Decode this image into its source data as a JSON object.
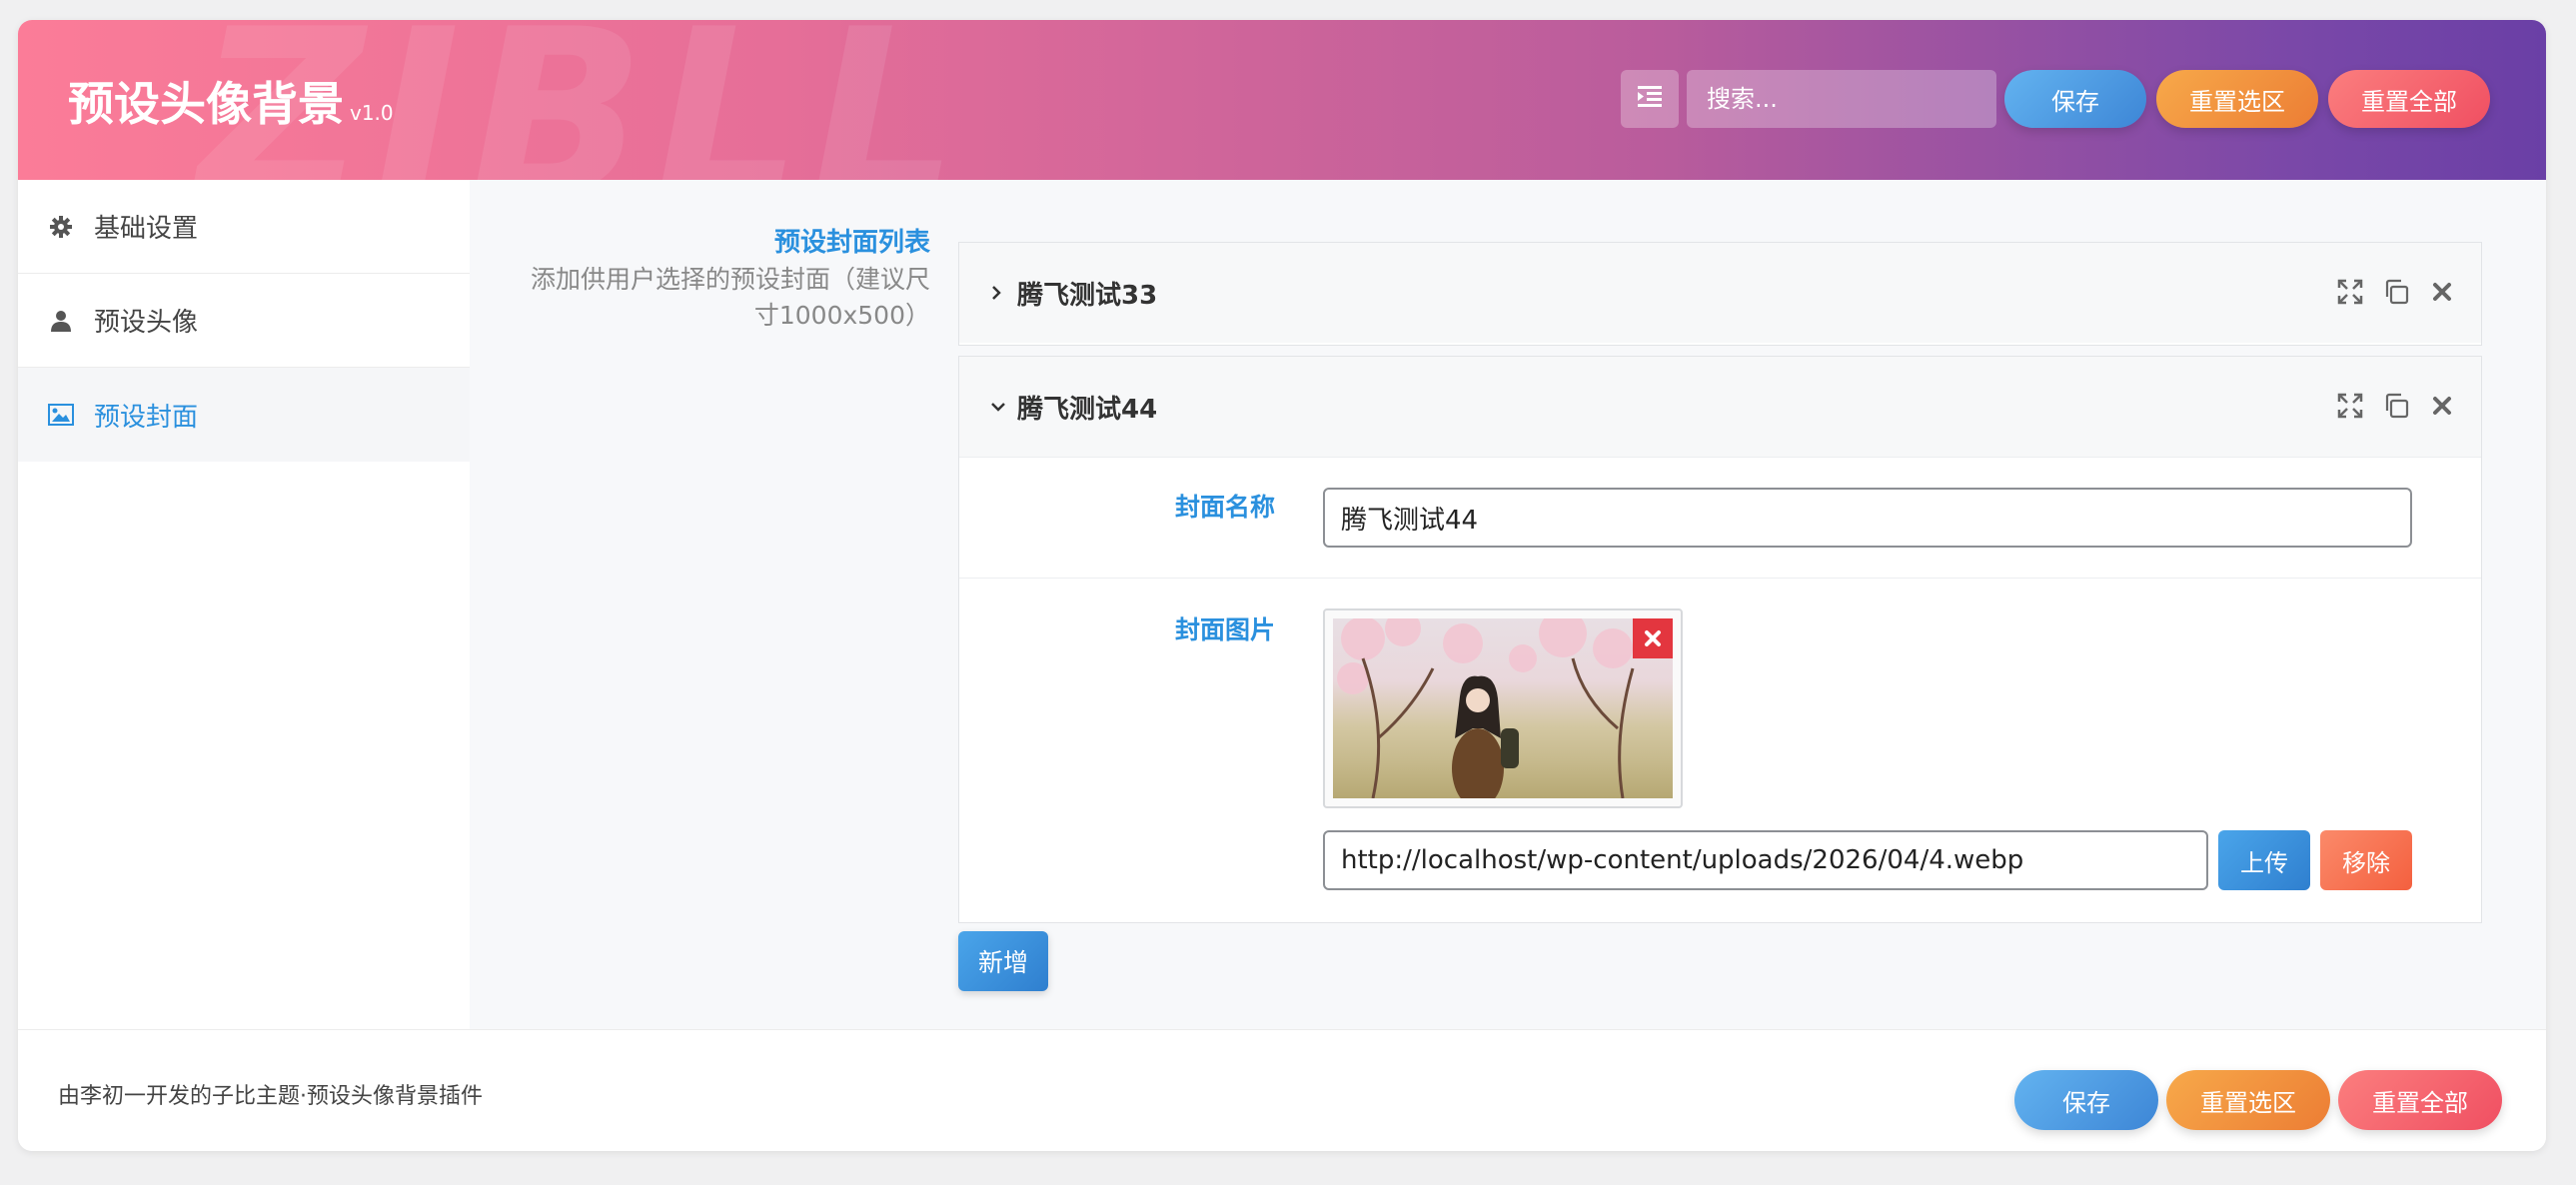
{
  "header": {
    "title": "预设头像背景",
    "version": "v1.0",
    "watermark": "ZIBLL",
    "search_placeholder": "搜索...",
    "save_label": "保存",
    "reset_section_label": "重置选区",
    "reset_all_label": "重置全部"
  },
  "sidebar": {
    "items": [
      {
        "label": "基础设置",
        "icon": "gear-icon"
      },
      {
        "label": "预设头像",
        "icon": "user-icon"
      },
      {
        "label": "预设封面",
        "icon": "image-icon",
        "active": true
      }
    ]
  },
  "main": {
    "field_title": "预设封面列表",
    "field_description": "添加供用户选择的预设封面（建议尺寸1000x500）",
    "groups": [
      {
        "title": "腾飞测试33",
        "expanded": false
      },
      {
        "title": "腾飞测试44",
        "expanded": true,
        "name_label": "封面名称",
        "name_value": "腾飞测试44",
        "image_label": "封面图片",
        "image_url": "http://localhost/wp-content/uploads/2026/04/4.webp",
        "upload_label": "上传",
        "remove_label": "移除"
      }
    ],
    "add_label": "新增"
  },
  "footer": {
    "text": "由李初一开发的子比主题·预设头像背景插件",
    "save_label": "保存",
    "reset_section_label": "重置选区",
    "reset_all_label": "重置全部"
  },
  "colors": {
    "accent": "#2a90de",
    "header_gradient_start": "#fb7c98",
    "header_gradient_end": "#6a3fa6",
    "danger": "#e3363f"
  }
}
